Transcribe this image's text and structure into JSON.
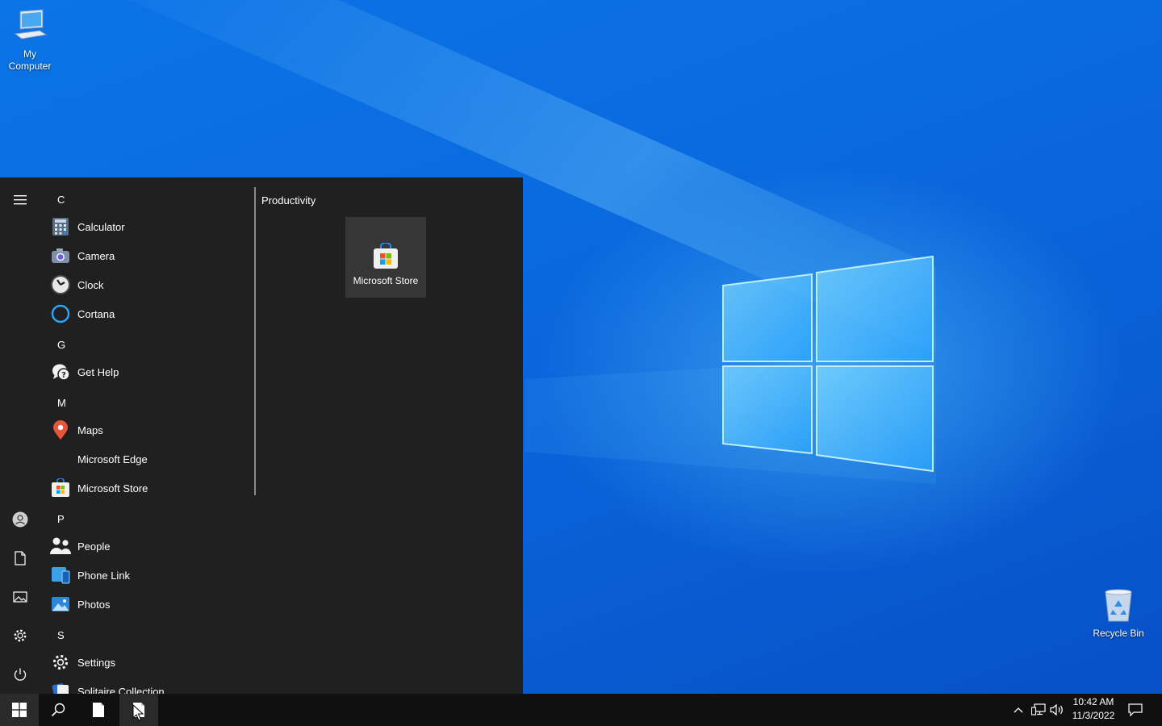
{
  "desktop": {
    "icons": [
      {
        "label_line1": "My",
        "label_line2": "Computer",
        "icon": "computer-icon"
      },
      {
        "label": "Recycle Bin",
        "icon": "recycle-bin-icon"
      }
    ]
  },
  "start_menu": {
    "rail": [
      "hamburger-icon",
      "user-icon",
      "documents-icon",
      "pictures-icon",
      "settings-icon",
      "power-icon"
    ],
    "sections": [
      {
        "letter": "C",
        "apps": [
          {
            "label": "Calculator",
            "icon": "calculator-icon"
          },
          {
            "label": "Camera",
            "icon": "camera-icon"
          },
          {
            "label": "Clock",
            "icon": "clock-icon"
          },
          {
            "label": "Cortana",
            "icon": "cortana-icon"
          }
        ]
      },
      {
        "letter": "G",
        "apps": [
          {
            "label": "Get Help",
            "icon": "get-help-icon"
          }
        ]
      },
      {
        "letter": "M",
        "apps": [
          {
            "label": "Maps",
            "icon": "maps-icon"
          },
          {
            "label": "Microsoft Edge",
            "icon": ""
          },
          {
            "label": "Microsoft Store",
            "icon": "store-icon"
          }
        ]
      },
      {
        "letter": "P",
        "apps": [
          {
            "label": "People",
            "icon": "people-icon"
          },
          {
            "label": "Phone Link",
            "icon": "phone-link-icon"
          },
          {
            "label": "Photos",
            "icon": "photos-icon"
          }
        ]
      },
      {
        "letter": "S",
        "apps": [
          {
            "label": "Settings",
            "icon": "settings-icon"
          },
          {
            "label": "Solitaire Collection",
            "icon": "solitaire-icon"
          }
        ]
      }
    ],
    "tiles": {
      "group_title": "Productivity",
      "items": [
        {
          "label": "Microsoft Store",
          "icon": "store-icon"
        }
      ]
    }
  },
  "taskbar": {
    "buttons": [
      "windows-start-icon",
      "search-icon",
      "file-icon",
      "file-icon"
    ],
    "tray": [
      "chevron-up-icon",
      "network-icon",
      "volume-icon"
    ],
    "clock": {
      "time": "10:42 AM",
      "date": "11/3/2022"
    },
    "notifications_icon": "action-center-icon"
  },
  "colors": {
    "start_bg": "#202020",
    "taskbar_bg": "#101010",
    "tile_bg": "#363636",
    "desktop_blue": "#0a62d8"
  }
}
